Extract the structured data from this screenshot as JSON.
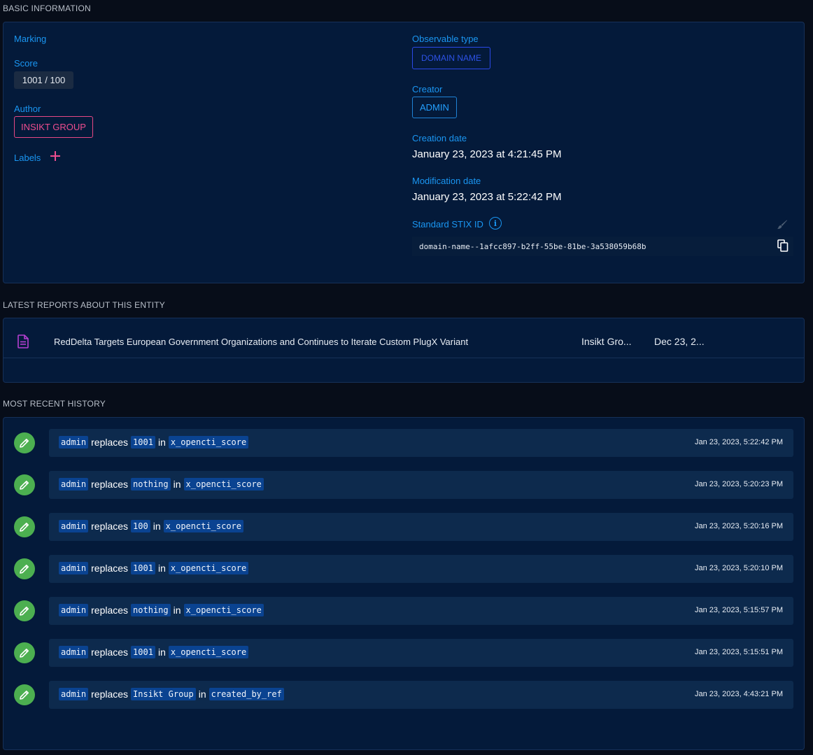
{
  "basic": {
    "section_title": "BASIC INFORMATION",
    "marking_label": "Marking",
    "score_label": "Score",
    "score_value": "1001 / 100",
    "author_label": "Author",
    "author_value": "INSIKT GROUP",
    "labels_label": "Labels",
    "observable_type_label": "Observable type",
    "observable_type_value": "DOMAIN NAME",
    "creator_label": "Creator",
    "creator_value": "ADMIN",
    "creation_date_label": "Creation date",
    "creation_date_value": "January 23, 2023 at 4:21:45 PM",
    "modification_date_label": "Modification date",
    "modification_date_value": "January 23, 2023 at 5:22:42 PM",
    "stix_id_label": "Standard STIX ID",
    "stix_id_value": "domain-name--1afcc897-b2ff-55be-81be-3a538059b68b"
  },
  "reports": {
    "section_title": "LATEST REPORTS ABOUT THIS ENTITY",
    "items": [
      {
        "title": "RedDelta Targets European Government Organizations and Continues to Iterate Custom PlugX Variant",
        "author": "Insikt Gro...",
        "date": "Dec 23, 2..."
      }
    ]
  },
  "history": {
    "section_title": "MOST RECENT HISTORY",
    "items": [
      {
        "user": "admin",
        "verb": "replaces",
        "value": "1001",
        "prep": "in",
        "field": "x_opencti_score",
        "date": "Jan 23, 2023, 5:22:42 PM"
      },
      {
        "user": "admin",
        "verb": "replaces",
        "value": "nothing",
        "prep": "in",
        "field": "x_opencti_score",
        "date": "Jan 23, 2023, 5:20:23 PM"
      },
      {
        "user": "admin",
        "verb": "replaces",
        "value": "100",
        "prep": "in",
        "field": "x_opencti_score",
        "date": "Jan 23, 2023, 5:20:16 PM"
      },
      {
        "user": "admin",
        "verb": "replaces",
        "value": "1001",
        "prep": "in",
        "field": "x_opencti_score",
        "date": "Jan 23, 2023, 5:20:10 PM"
      },
      {
        "user": "admin",
        "verb": "replaces",
        "value": "nothing",
        "prep": "in",
        "field": "x_opencti_score",
        "date": "Jan 23, 2023, 5:15:57 PM"
      },
      {
        "user": "admin",
        "verb": "replaces",
        "value": "1001",
        "prep": "in",
        "field": "x_opencti_score",
        "date": "Jan 23, 2023, 5:15:51 PM"
      },
      {
        "user": "admin",
        "verb": "replaces",
        "value": "Insikt Group",
        "prep": "in",
        "field": "created_by_ref",
        "date": "Jan 23, 2023, 4:43:21 PM"
      }
    ]
  },
  "icons": {
    "add_label": "plus-icon",
    "stix_info": "info-icon",
    "stix_edit": "brush-icon",
    "stix_copy": "copy-icon",
    "report": "document-icon",
    "history_entry": "pencil-icon"
  },
  "colors": {
    "background": "#070d19",
    "panel": "#041a3a",
    "accent_blue": "#1a96f2",
    "author_pink": "#ee4d8f",
    "history_green": "#4caf50",
    "code_highlight": "#0a4391"
  }
}
